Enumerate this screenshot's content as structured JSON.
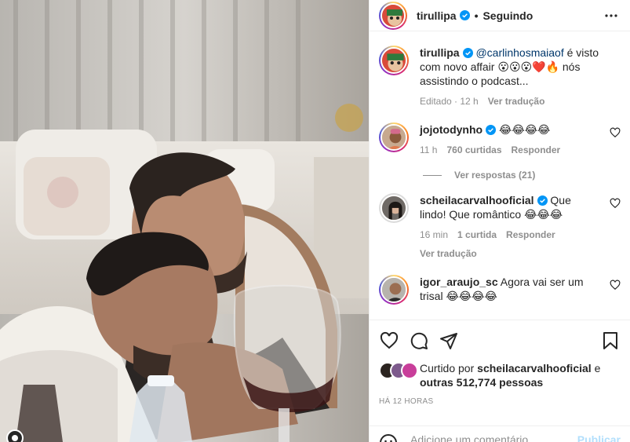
{
  "header": {
    "username": "tirullipa",
    "separator": "•",
    "follow_state": "Seguindo"
  },
  "caption": {
    "username": "tirullipa",
    "mention": "@carlinhosmaiaof",
    "text_part1": " é visto com novo affair 😮😮😮❤️🔥 nós assistindo o podcast...",
    "edited": "Editado · 12 h",
    "see_translation": "Ver tradução"
  },
  "comments": [
    {
      "username": "jojotodynho",
      "text": "😂😂😂😂",
      "time": "11 h",
      "likes": "760 curtidas",
      "reply": "Responder",
      "view_replies": "Ver respostas (21)"
    },
    {
      "username": "scheilacarvalhooficial",
      "text": "Que lindo! Que romântico 😂😂😂",
      "time": "16 min",
      "likes": "1 curtida",
      "reply": "Responder",
      "see_translation": "Ver tradução"
    },
    {
      "username": "igor_araujo_sc",
      "text": "Agora vai ser um trisal 😂😂😂😂"
    }
  ],
  "likes": {
    "prefix": "Curtido por ",
    "user": "scheilacarvalhooficial",
    "middle": " e ",
    "others": "outras 512,774 pessoas"
  },
  "timestamp": "HÁ 12 HORAS",
  "add_comment": {
    "placeholder": "Adicione um comentário...",
    "publish": "Publicar"
  },
  "colors": {
    "link": "#00376b",
    "secondary_text": "#8e8e8e",
    "verified": "#0095f6",
    "publish_disabled": "#b2dffc"
  },
  "icons": {
    "more": "more-horizontal-icon",
    "like": "heart-icon",
    "comment": "comment-bubble-icon",
    "share": "paper-plane-icon",
    "save": "bookmark-icon",
    "emoji": "emoji-smile-icon"
  }
}
